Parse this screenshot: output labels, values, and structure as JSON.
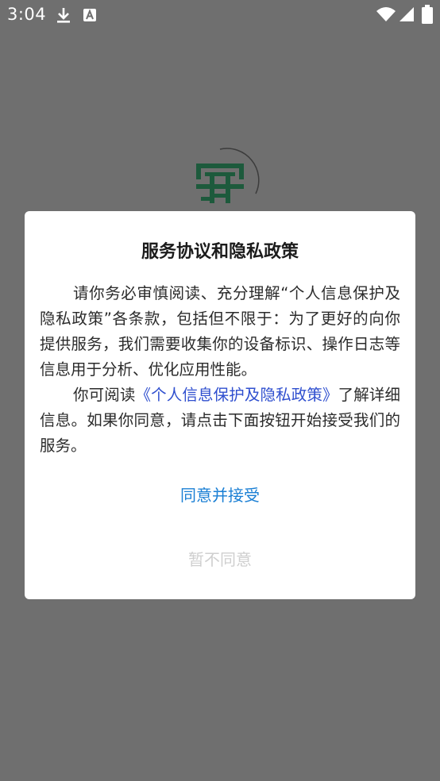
{
  "status_bar": {
    "time": "3:04",
    "icons": [
      "download-icon",
      "a-icon",
      "wifi-icon",
      "signal-icon",
      "battery-icon"
    ]
  },
  "background": {
    "logo_icon": "an-shield-logo-icon"
  },
  "dialog": {
    "title": "服务协议和隐私政策",
    "para1": "请你务必审慎阅读、充分理解“个人信息保护及隐私政策”各条款，包括但不限于：为了更好的向你提供服务，我们需要收集你的设备标识、操作日志等信息用于分析、优化应用性能。",
    "para2_prefix": "你可阅读",
    "para2_link": "《个人信息保护及隐私政策》",
    "para2_suffix": "了解详细信息。如果你同意，请点击下面按钮开始接受我们的服务。",
    "agree_label": "同意并接受",
    "disagree_label": "暂不同意"
  },
  "colors": {
    "overlay": "#6f6f6f",
    "link": "#2f4fcf",
    "agree": "#1a7fd4",
    "disagree": "#cfcfcf"
  }
}
